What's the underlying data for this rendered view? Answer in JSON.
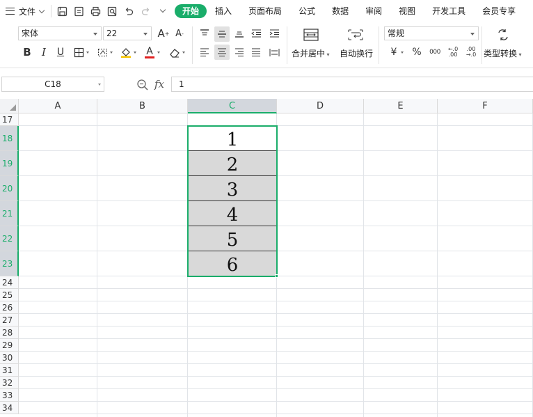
{
  "menubar": {
    "file_label": "文件",
    "tabs": [
      {
        "label": "开始",
        "active": true
      },
      {
        "label": "插入"
      },
      {
        "label": "页面布局"
      },
      {
        "label": "公式"
      },
      {
        "label": "数据"
      },
      {
        "label": "审阅"
      },
      {
        "label": "视图"
      },
      {
        "label": "开发工具"
      },
      {
        "label": "会员专享"
      }
    ],
    "accent_color": "#1aad6a"
  },
  "ribbon": {
    "font_name": "宋体",
    "font_size": "22",
    "bold": "B",
    "italic": "I",
    "underline": "U",
    "font_color_glyph": "A",
    "merge_label": "合并居中",
    "wrap_label": "自动换行",
    "number_format": "常规",
    "currency_glyph": "¥",
    "percent_glyph": "%",
    "thousands_glyph": "000",
    "inc_decimal_glyph": ".00",
    "dec_decimal_glyph": ".00",
    "convert_label": "类型转换",
    "grow_font_glyph": "A",
    "shrink_font_glyph": "A"
  },
  "formula_bar": {
    "name_box": "C18",
    "fx": "fx",
    "content": "1"
  },
  "grid": {
    "columns": [
      "A",
      "B",
      "C",
      "D",
      "E",
      "F"
    ],
    "selected_column": "C",
    "rows": [
      "17",
      "18",
      "19",
      "20",
      "21",
      "22",
      "23",
      "24",
      "25",
      "26",
      "27",
      "28",
      "29",
      "30",
      "31",
      "32",
      "33",
      "34"
    ],
    "selected_rows": [
      "18",
      "19",
      "20",
      "21",
      "22",
      "23"
    ],
    "cells_C": [
      "1",
      "2",
      "3",
      "4",
      "5",
      "6"
    ],
    "active_cell": "C18",
    "selection_range": "C18:C23",
    "shade_color": "#d9d9d9"
  }
}
